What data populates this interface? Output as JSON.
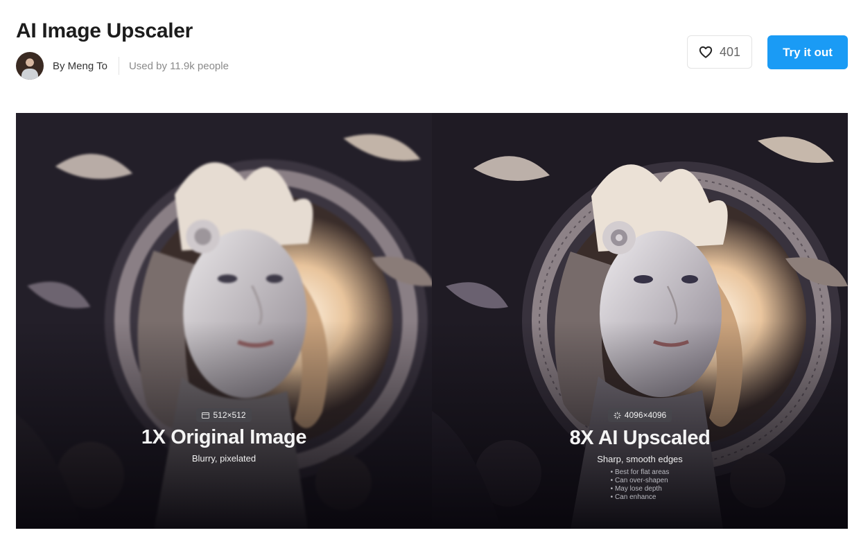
{
  "header": {
    "title": "AI Image Upscaler",
    "author": "By Meng To",
    "usage": "Used by 11.9k people"
  },
  "actions": {
    "like_count": "401",
    "try_label": "Try it out"
  },
  "comparison": {
    "left": {
      "badge": "512×512",
      "heading": "1X Original Image",
      "subtitle": "Blurry, pixelated"
    },
    "right": {
      "badge": "4096×4096",
      "heading": "8X AI Upscaled",
      "subtitle": "Sharp, smooth edges",
      "bullets": [
        "Best for flat areas",
        "Can over-shapen",
        "May lose depth",
        "Can enhance"
      ]
    }
  },
  "colors": {
    "accent": "#1a9bf5",
    "artwork_dark": "#1f1b24",
    "artwork_glow": "#f3dcc0"
  }
}
